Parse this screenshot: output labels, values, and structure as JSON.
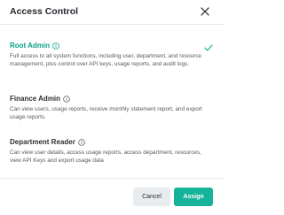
{
  "dialog": {
    "title": "Access Control",
    "close_icon": "close-icon"
  },
  "roles": [
    {
      "title": "Root Admin",
      "description": "Full access to all system functions, including user, department, and resource management, plus control over API keys, usage reports, and audit logs.",
      "selected": true
    },
    {
      "title": "Finance Admin",
      "description": "Can view users, usage reports, receive monthly statement report, and export usage reports.",
      "selected": false
    },
    {
      "title": "Department Reader",
      "description": "Can view user details, access usage reports, access department, resources, view API Keys and export usage data",
      "selected": false
    }
  ],
  "icons": {
    "info": "info-icon",
    "selected": "checkmark-icon"
  },
  "footer": {
    "cancel_label": "Cancel",
    "assign_label": "Assign"
  },
  "colors": {
    "accent": "#14b39a",
    "selected_title": "#0a9e8a",
    "secondary_button": "#e9ecef"
  }
}
